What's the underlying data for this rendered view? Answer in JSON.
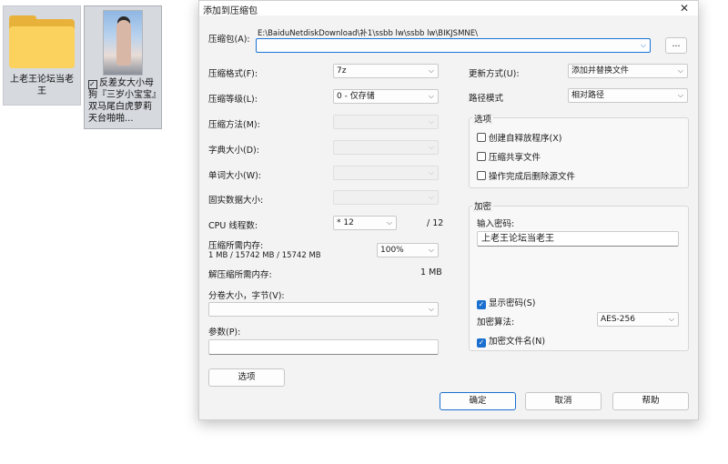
{
  "desktop": {
    "items": [
      {
        "label": "上老王论坛当老王"
      },
      {
        "label": "反差女大小母狗『三岁小宝宝』双马尾白虎萝莉 天台啪啪..."
      }
    ]
  },
  "dialog": {
    "title": "添加到压缩包",
    "archive": {
      "label": "压缩包(A):",
      "path": "E:\\BaiduNetdiskDownload\\补1\\ssbb lw\\ssbb lw\\BIKJSMNE\\",
      "browse": "..."
    },
    "format": {
      "label": "压缩格式(F):",
      "value": "7z"
    },
    "level": {
      "label": "压缩等级(L):",
      "value": "0 - 仅存储"
    },
    "method": {
      "label": "压缩方法(M):"
    },
    "dict": {
      "label": "字典大小(D):"
    },
    "word": {
      "label": "单词大小(W):"
    },
    "solid": {
      "label": "固实数据大小:"
    },
    "cpu": {
      "label": "CPU 线程数:",
      "value": "* 12",
      "max": "/ 12"
    },
    "mem_comp": {
      "label": "压缩所需内存:",
      "detail": "1 MB / 15742 MB / 15742 MB",
      "value": "100%"
    },
    "mem_decomp": {
      "label": "解压缩所需内存:",
      "value": "1 MB"
    },
    "split": {
      "label": "分卷大小，字节(V):"
    },
    "params": {
      "label": "参数(P):"
    },
    "options_btn": "选项",
    "update": {
      "label": "更新方式(U):",
      "value": "添加并替换文件"
    },
    "pathmode": {
      "label": "路径模式",
      "value": "相对路径"
    },
    "options_group": {
      "title": "选项",
      "items": [
        {
          "label": "创建自释放程序(X)",
          "checked": false
        },
        {
          "label": "压缩共享文件",
          "checked": false
        },
        {
          "label": "操作完成后删除源文件",
          "checked": false
        }
      ]
    },
    "encrypt": {
      "title": "加密",
      "pwd_label": "输入密码:",
      "pwd_value": "上老王论坛当老王",
      "show_pwd": "显示密码(S)",
      "algo_label": "加密算法:",
      "algo_value": "AES-256",
      "enc_names": "加密文件名(N)"
    },
    "buttons": {
      "ok": "确定",
      "cancel": "取消",
      "help": "帮助"
    },
    "close_icon": "✕",
    "arrow_icon": "⌵"
  }
}
